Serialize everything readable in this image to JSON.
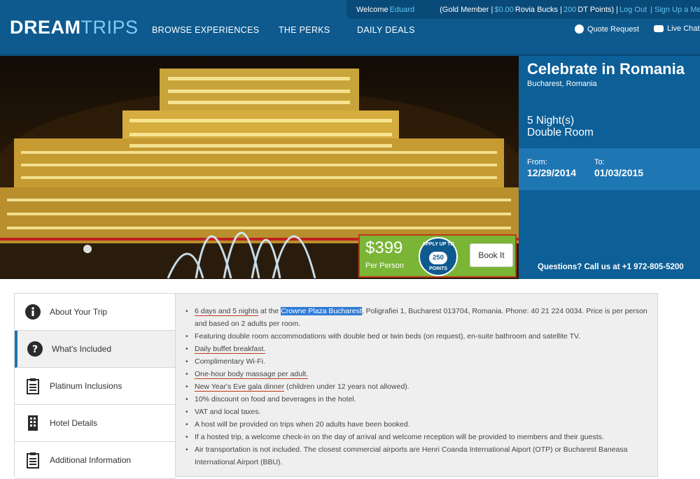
{
  "header": {
    "logo_bold": "DREAM",
    "logo_light": "TRIPS",
    "nav": [
      "BROWSE EXPERIENCES",
      "THE PERKS",
      "DAILY DEALS"
    ],
    "quote_request": "Quote Request",
    "live_chat": "Live Chat",
    "topbar": {
      "welcome": "Welcome",
      "user": "Eduard",
      "member_prefix": "(Gold Member |",
      "rovia": "$0.00",
      "rovia_label": "Rovia Bucks |",
      "dt_points": "200",
      "dt_label": "DT Points) |",
      "logout": "Log Out",
      "signup": "Sign Up a Member"
    }
  },
  "trip": {
    "title": "Celebrate in Romania",
    "location": "Bucharest, Romania",
    "nights": "5 Night(s)",
    "room": "Double Room",
    "from_label": "From:",
    "from_date": "12/29/2014",
    "to_label": "To:",
    "to_date": "01/03/2015",
    "questions": "Questions? Call us at +1 972-805-5200"
  },
  "pricing": {
    "price": "$399",
    "per_person": "Per Person",
    "badge_top": "APPLY UP TO",
    "badge_points": "250",
    "badge_bottom": "POINTS",
    "book": "Book It"
  },
  "tabs": [
    {
      "label": "About Your Trip",
      "icon": "info-icon"
    },
    {
      "label": "What's Included",
      "icon": "question-icon"
    },
    {
      "label": "Platinum Inclusions",
      "icon": "clipboard-icon"
    },
    {
      "label": "Hotel Details",
      "icon": "building-icon"
    },
    {
      "label": "Additional Information",
      "icon": "clipboard-icon"
    }
  ],
  "included": {
    "item1": {
      "underlined": "6 days and 5 nights",
      "mid": " at the ",
      "highlight": "Crowne Plaza Bucharest",
      "rest": ", Poligrafiei 1, Bucharest 013704, Romania. Phone: 40 21 224 0034. Price is per person and based on 2 adults per room."
    },
    "item2": "Featuring double room accommodations with double bed or twin beds (on request), en-suite bathroom and satellite TV.",
    "item3": "Daily buffet breakfast.",
    "item4": "Complimentary Wi-Fi.",
    "item5": "One-hour body massage per adult.",
    "item6_underlined": "New Year's Eve gala dinner",
    "item6_rest": " (children under 12 years not allowed).",
    "item7": "10% discount on food and beverages in the hotel.",
    "item8": "VAT and local taxes.",
    "item9": "A host will be provided on trips when 20 adults have been booked.",
    "item10": "If a hosted trip, a welcome check-in on the day of arrival and welcome reception will be provided to members and their guests.",
    "item11": "Air transportation is not included. The closest commercial airports are Henri Coanda International Aiport (OTP) or Bucharest Baneasa International Airport (BBU)."
  },
  "colors": {
    "header": "#0e5a8f",
    "accent": "#7ab536",
    "highlight": "#2f7bd6",
    "underline": "#c03a1a"
  }
}
